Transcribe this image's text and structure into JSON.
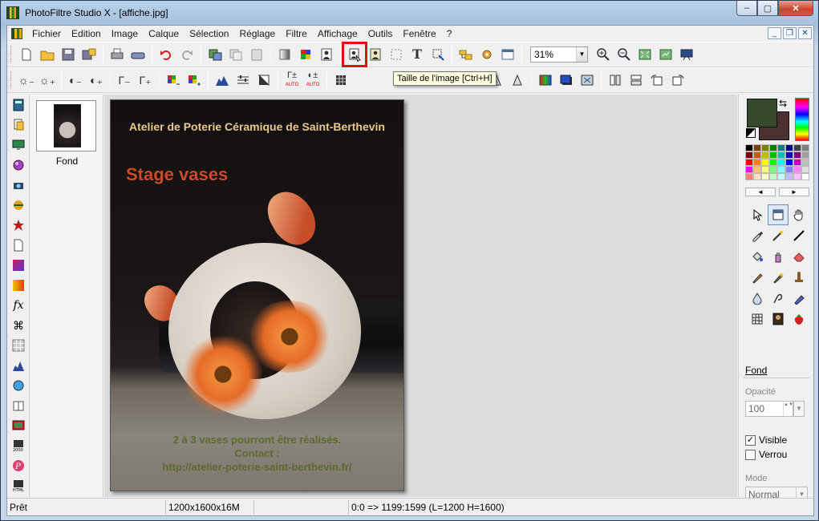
{
  "window": {
    "title": "PhotoFiltre Studio X - [affiche.jpg]",
    "min_label": "–",
    "max_label": "▢",
    "close_label": "✕"
  },
  "menu": {
    "items": [
      "Fichier",
      "Edition",
      "Image",
      "Calque",
      "Sélection",
      "Réglage",
      "Filtre",
      "Affichage",
      "Outils",
      "Fenêtre",
      "?"
    ],
    "mdi_min": "_",
    "mdi_restore": "❐",
    "mdi_close": "✕"
  },
  "toolbar": {
    "zoom_value": "31%",
    "zoom_dropdown_glyph": "▼",
    "tooltip": "Taille de l'image [Ctrl+H]",
    "text_tool_glyph": "T"
  },
  "layers": {
    "thumbnail_label": "Fond"
  },
  "poster": {
    "header": "Atelier de Poterie Céramique de Saint-Berthevin",
    "title": "Stage vases",
    "line1": "2 à 3 vases pourront être réalisés.",
    "line2": "Contact :",
    "line3": "http://atelier-poterie-saint-berthevin.fr/"
  },
  "right_panel": {
    "layer_name": "Fond",
    "opacity_label": "Opacité",
    "opacity_value": "100",
    "visible_label": "Visible",
    "visible_checked": true,
    "lock_label": "Verrou",
    "lock_checked": false,
    "mode_label": "Mode",
    "mode_value": "Normal",
    "fg_color": "#344a2b",
    "bg_color": "#4a3130",
    "swap_glyph": "⇆",
    "pal_prev": "◄",
    "pal_next": "►",
    "checkmark": "✓",
    "arrows_glyph": "▲▼",
    "dropdown_glyph": "▼"
  },
  "statusbar": {
    "status": "Prêt",
    "image_size": "1200x1600x16M",
    "origin": "0:0",
    "coords": "=> 1199:1599 (L=1200  H=1600)"
  },
  "colors": {
    "highlight_red": "#e01010",
    "tooltip_bg": "#ffffe1",
    "poster_title": "#c84a2b",
    "poster_header": "#e7c98e",
    "poster_footer": "#5c6a2d"
  }
}
